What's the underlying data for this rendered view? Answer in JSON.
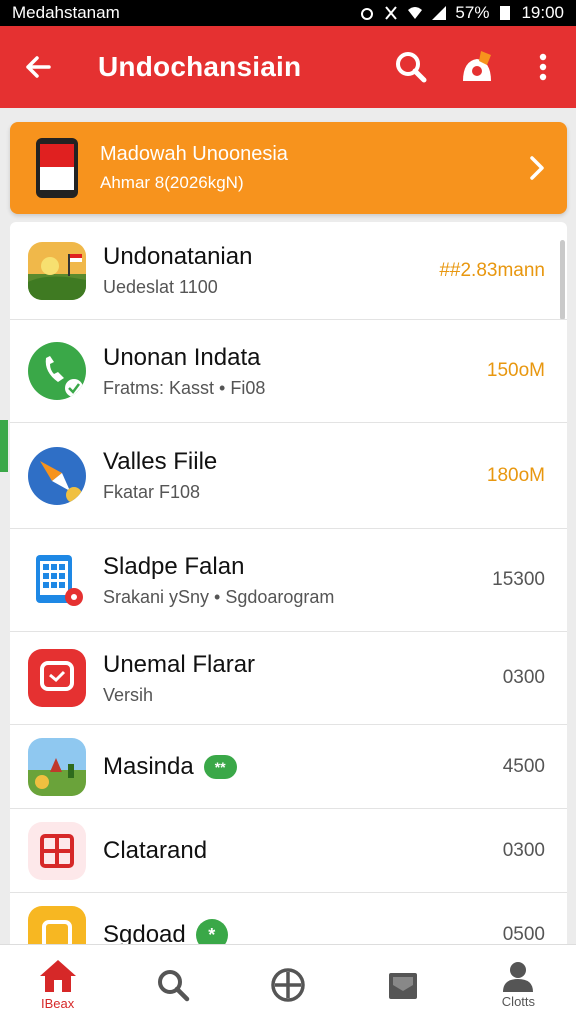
{
  "status_bar": {
    "carrier": "Medahstanam",
    "battery": "57%",
    "time": "19:00"
  },
  "header": {
    "title": "Undochansiain"
  },
  "banner": {
    "title": "Madowah Unoonesia",
    "subtitle": "Ahmar 8(2026kgN)"
  },
  "list": {
    "items": [
      {
        "title": "Undonatanian",
        "subtitle": "Uedeslat 1100",
        "value": "##2.83mann",
        "value_style": "orange",
        "icon": "landscape-flag-icon"
      },
      {
        "title": "Unonan Indata",
        "subtitle": "Fratms: Kasst • Fi08",
        "value": "150oM",
        "value_style": "orange",
        "icon": "phone-call-icon"
      },
      {
        "title": "Valles Fiile",
        "subtitle": "Fkatar F108",
        "value": "180oM",
        "value_style": "orange",
        "icon": "compass-icon"
      },
      {
        "title": "Sladpe Falan",
        "subtitle": "Srakani ySny • Sgdoarogram",
        "value": "15300",
        "value_style": "gray",
        "icon": "calculator-icon"
      },
      {
        "title": "Unemal Flarar",
        "subtitle": "Versih",
        "value": "0300",
        "value_style": "gray",
        "icon": "message-icon"
      },
      {
        "title": "Masinda",
        "subtitle": "",
        "badge": "**",
        "value": "4500",
        "value_style": "gray",
        "icon": "landscape-icon"
      },
      {
        "title": "Clatarand",
        "subtitle": "",
        "value": "0300",
        "value_style": "gray",
        "icon": "grid-icon"
      },
      {
        "title": "Sgdoad",
        "subtitle": "",
        "badge_dot": "*",
        "value": "0500",
        "value_style": "gray",
        "icon": "folder-icon"
      }
    ]
  },
  "bottom_nav": {
    "items": [
      {
        "label": "IBeax",
        "icon": "home-icon",
        "active": true
      },
      {
        "label": "",
        "icon": "search-icon"
      },
      {
        "label": "",
        "icon": "add-circle-icon"
      },
      {
        "label": "",
        "icon": "inbox-icon"
      },
      {
        "label": "Clotts",
        "icon": "profile-icon"
      }
    ]
  },
  "colors": {
    "app_bar": "#e53131",
    "banner": "#f7931d",
    "accent_green": "#3aa848",
    "value_orange": "#e8970f"
  }
}
